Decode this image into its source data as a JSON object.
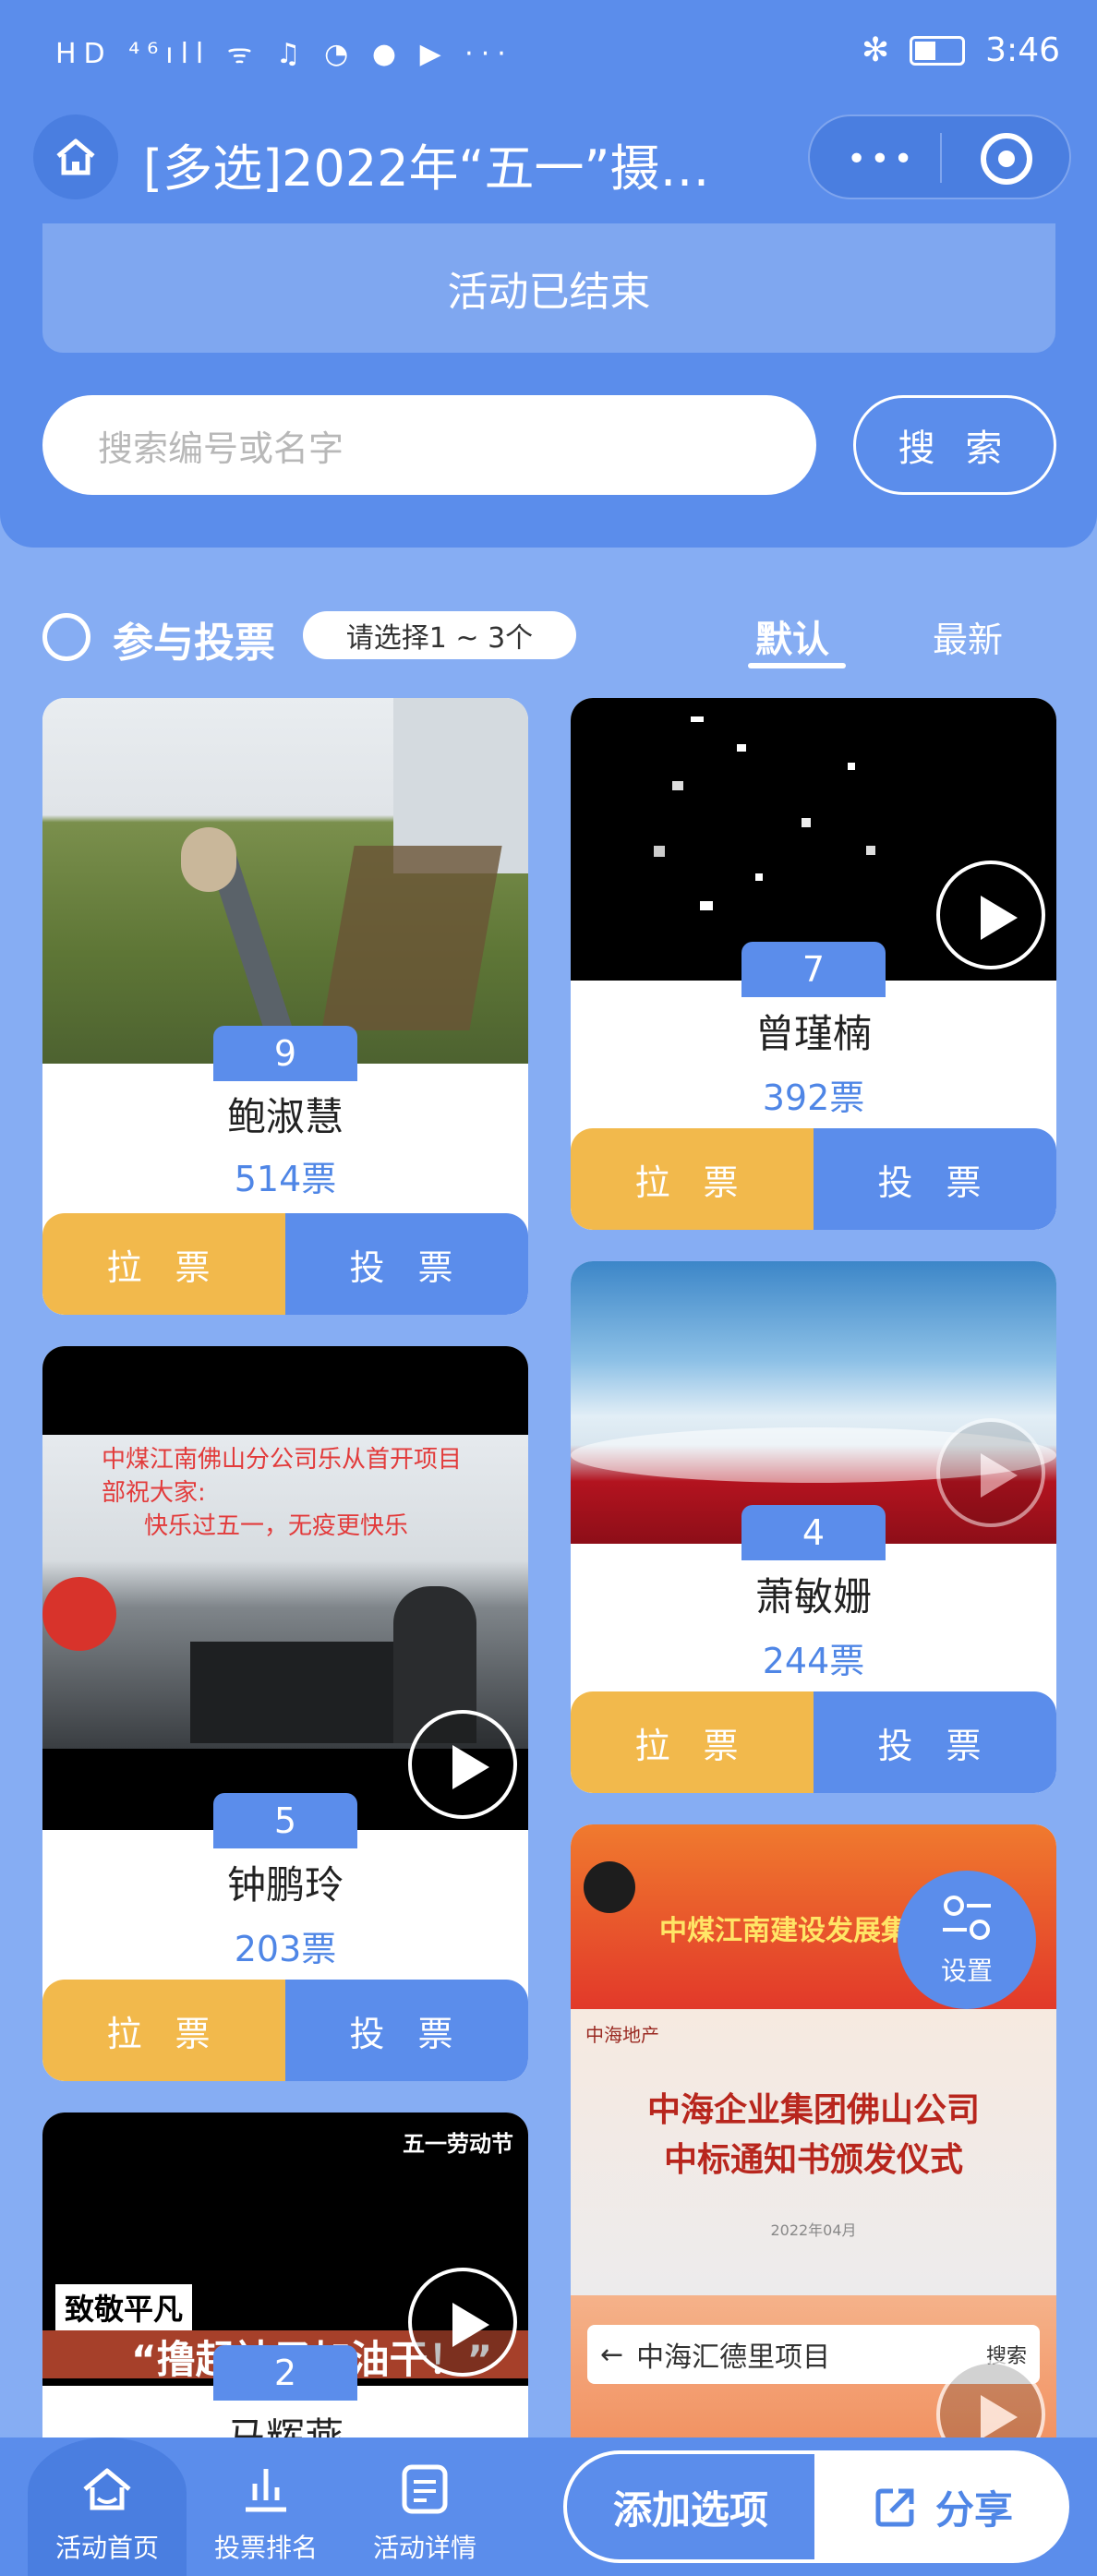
{
  "status_bar": {
    "left": "HD ⁴⁶ıll ᯤ ♫ ◔ ● ▶ ···",
    "time": "3:46",
    "battery": "▭",
    "bluetooth": "✻"
  },
  "nav": {
    "title": "[多选]2022年“五一”摄…",
    "more": "•••"
  },
  "banner": {
    "text": "活动已结束"
  },
  "search": {
    "placeholder": "搜索编号或名字",
    "button": "搜 索"
  },
  "vote_bar": {
    "title": "参与投票",
    "hint": "请选择1 ~ 3个",
    "sort_default": "默认",
    "sort_latest": "最新"
  },
  "cards": [
    {
      "number": "9",
      "name": "鲍淑慧",
      "votes": "514票",
      "canvass": "拉 票",
      "vote": "投 票"
    },
    {
      "number": "7",
      "name": "曾瑾楠",
      "votes": "392票",
      "canvass": "拉 票",
      "vote": "投 票"
    },
    {
      "number": "5",
      "name": "钟鹏玲",
      "votes": "203票",
      "canvass": "拉 票",
      "vote": "投 票"
    },
    {
      "number": "4",
      "name": "萧敏姗",
      "votes": "244票",
      "canvass": "拉 票",
      "vote": "投 票"
    },
    {
      "number": "2",
      "name": "马辉燕"
    }
  ],
  "card5_text": {
    "caption_top": "中煤江南佛山分公司乐从首开项目",
    "caption_2": "部祝大家:",
    "caption_3": "快乐过五一，无疫更快乐"
  },
  "card_labor": {
    "tag": "五一劳动节",
    "slogan_1": "致敬平凡",
    "slogan_2": "“撸起袖子加油干！”"
  },
  "card_poster": {
    "company": "中煤江南建设发展集团公司",
    "line1": "中海企业集团佛山公司",
    "line2": "中标通知书颁发仪式",
    "date": "2022年04月",
    "search_text": "中海汇德里项目",
    "search_btn": "搜索",
    "logo_text": "中海地产"
  },
  "fab": {
    "label": "设置"
  },
  "tabbar": [
    {
      "label": "活动首页"
    },
    {
      "label": "投票排名"
    },
    {
      "label": "活动详情"
    }
  ],
  "actions": {
    "add": "添加选项",
    "share": "分享"
  }
}
